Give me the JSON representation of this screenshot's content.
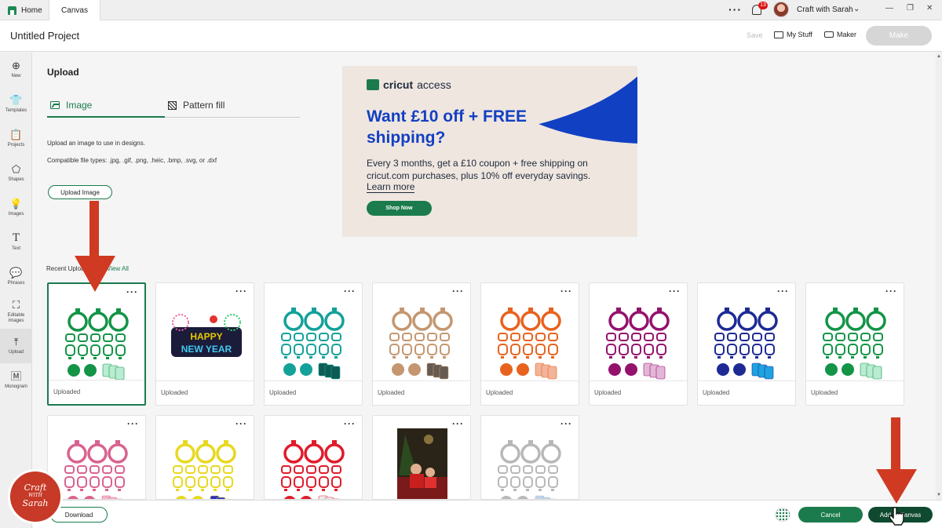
{
  "tabs": {
    "home": "Home",
    "canvas": "Canvas"
  },
  "topbar": {
    "notifications": "13",
    "user": "Craft with Sarah"
  },
  "header": {
    "title": "Untitled Project",
    "save": "Save",
    "my_stuff": "My Stuff",
    "maker": "Maker",
    "make": "Make"
  },
  "sidebar": [
    {
      "label": "New",
      "icon": "plus-circle-icon"
    },
    {
      "label": "Templates",
      "icon": "shirt-icon"
    },
    {
      "label": "Projects",
      "icon": "clipboard-icon"
    },
    {
      "label": "Shapes",
      "icon": "shapes-icon"
    },
    {
      "label": "Images",
      "icon": "lightbulb-icon"
    },
    {
      "label": "Text",
      "icon": "text-icon"
    },
    {
      "label": "Phrases",
      "icon": "speech-bubble-icon"
    },
    {
      "label": "Editable Images",
      "icon": "editable-image-icon"
    },
    {
      "label": "Upload",
      "icon": "upload-icon"
    },
    {
      "label": "Monogram",
      "icon": "monogram-icon"
    }
  ],
  "upload": {
    "heading": "Upload",
    "tab_image": "Image",
    "tab_pattern": "Pattern fill",
    "desc1": "Upload an image to use in designs.",
    "desc2": "Compatible file types: .jpg, .gif, .png, .heic, .bmp, .svg, or .dxf",
    "upload_button": "Upload Image"
  },
  "ad": {
    "brand_a": "cricut",
    "brand_b": "access",
    "headline": "Want £10 off + FREE shipping?",
    "body": "Every 3 months, get a £10 coupon + free shipping on cricut.com purchases, plus 10% off everyday savings.",
    "learn_more": "Learn more",
    "shop_now": "Shop Now"
  },
  "recent": {
    "label": "Recent Uploads",
    "view_all": "View All",
    "items": [
      {
        "caption": "Uploaded",
        "color": "#139447",
        "accent": "#b9ecd3",
        "kind": "ornament"
      },
      {
        "caption": "Uploaded",
        "color": "#1b1b3a",
        "accent": "#e8c800",
        "kind": "newyear",
        "art_text": [
          "HAPPY",
          "NEW YEAR"
        ]
      },
      {
        "caption": "Uploaded",
        "color": "#13a19a",
        "accent": "#0d5c54",
        "kind": "ornament"
      },
      {
        "caption": "Uploaded",
        "color": "#c49770",
        "accent": "#665a52",
        "kind": "ornament"
      },
      {
        "caption": "Uploaded",
        "color": "#e8621f",
        "accent": "#f2b49a",
        "kind": "ornament"
      },
      {
        "caption": "Uploaded",
        "color": "#94126e",
        "accent": "#e3b6d8",
        "kind": "ornament"
      },
      {
        "caption": "Uploaded",
        "color": "#1e2a94",
        "accent": "#1ea3e0",
        "kind": "ornament"
      },
      {
        "caption": "Uploaded",
        "color": "#139447",
        "accent": "#b9ecd3",
        "kind": "ornament"
      },
      {
        "caption": "",
        "color": "#d9628f",
        "accent": "#f4b3cc",
        "kind": "ornament"
      },
      {
        "caption": "",
        "color": "#e8d820",
        "accent": "#2a2fc2",
        "kind": "ornament"
      },
      {
        "caption": "",
        "color": "#e01b2a",
        "accent": "#eeeeee",
        "kind": "ornament"
      },
      {
        "caption": "",
        "color": "#7a1a1a",
        "accent": "#2b4a1f",
        "kind": "photo"
      },
      {
        "caption": "",
        "color": "#b8b8b8",
        "accent": "#bcd3f2",
        "kind": "ornament"
      }
    ]
  },
  "bottom": {
    "download": "Download",
    "cancel": "Cancel",
    "add": "Add to Canvas"
  },
  "logo": {
    "line1": "Craft",
    "line2": "WITH",
    "line3": "Sarah"
  }
}
